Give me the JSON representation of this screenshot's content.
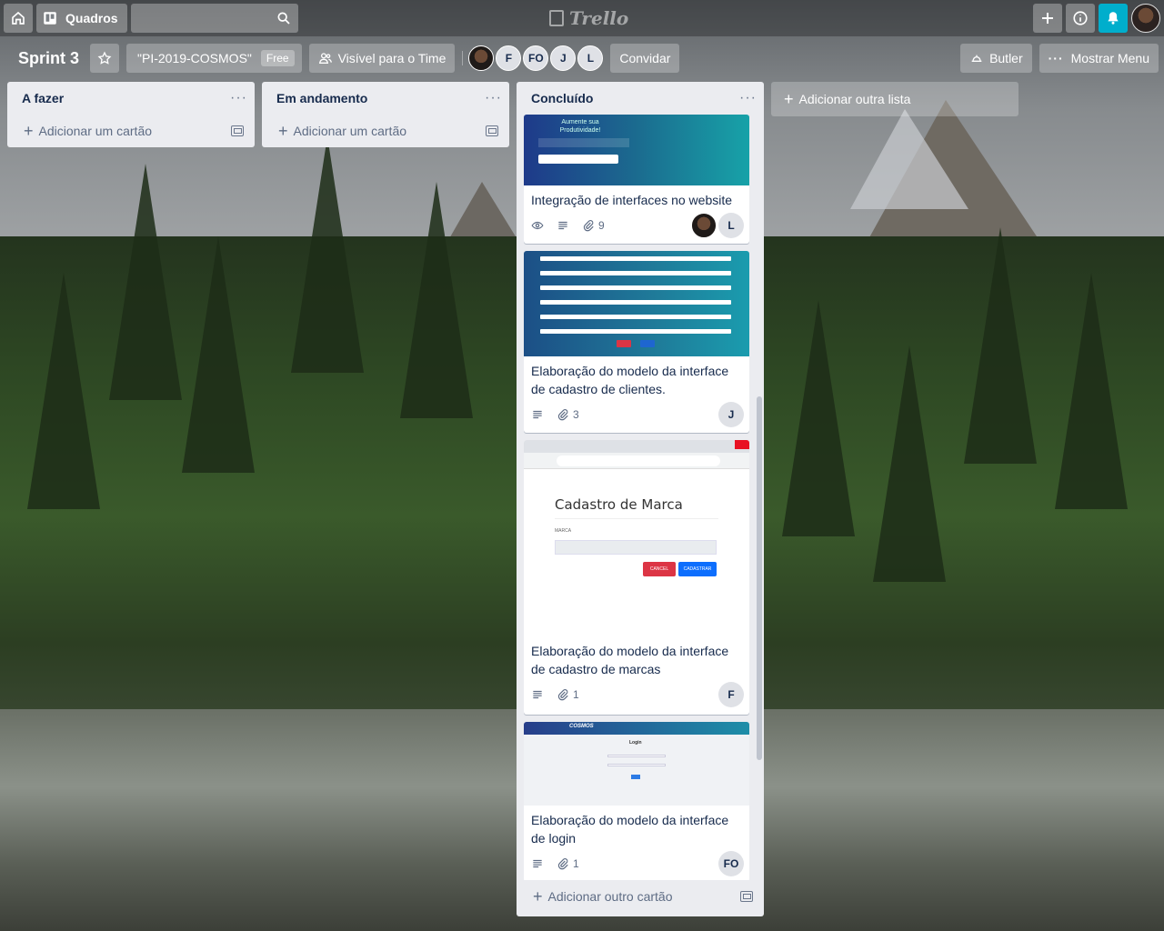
{
  "header": {
    "boards_label": "Quadros",
    "logo_text": "Trello"
  },
  "board": {
    "title": "Sprint 3",
    "team_name": "\"PI-2019-COSMOS\"",
    "plan_badge": "Free",
    "visibility_label": "Visível para o Time",
    "invite_label": "Convidar",
    "butler_label": "Butler",
    "menu_label": "Mostrar Menu",
    "members": [
      "F",
      "FO",
      "J",
      "L"
    ]
  },
  "lists": [
    {
      "title": "A fazer",
      "add_card_label": "Adicionar um cartão"
    },
    {
      "title": "Em andamento",
      "add_card_label": "Adicionar um cartão"
    },
    {
      "title": "Concluído",
      "add_card_label": "Adicionar outro cartão",
      "cards": [
        {
          "title": "Integração de interfaces no website",
          "attachments": "9",
          "members": [
            "L"
          ],
          "cover": {
            "heading": "Aumente sua Produtividade!"
          }
        },
        {
          "title": "Elaboração do modelo da interface de cadastro de clientes.",
          "attachments": "3",
          "members": [
            "J"
          ]
        },
        {
          "title": "Elaboração do modelo da interface de cadastro de marcas",
          "attachments": "1",
          "members": [
            "F"
          ],
          "cover": {
            "heading": "Cadastro de Marca",
            "field_label": "MARCA",
            "cancel": "CANCEL",
            "submit": "CADASTRAR"
          }
        },
        {
          "title": "Elaboração do modelo da interface de login",
          "attachments": "1",
          "members": [
            "FO"
          ],
          "cover": {
            "brand": "COSMOS",
            "heading": "Login"
          }
        }
      ]
    }
  ],
  "add_list_label": "Adicionar outra lista",
  "colors": {
    "list_bg": "#ebecf0",
    "notification": "#00aecc",
    "text": "#172b4d"
  }
}
